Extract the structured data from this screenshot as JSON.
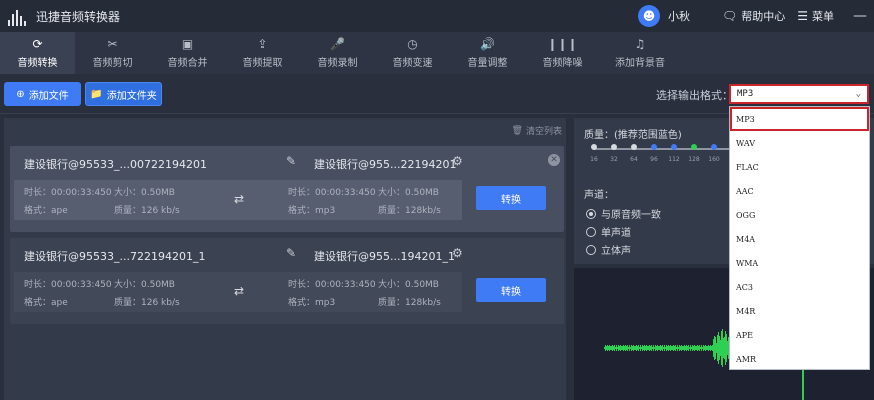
{
  "app": {
    "title": "迅捷音频转换器"
  },
  "user": {
    "avatar_icon": "user-icon",
    "name": "小秋"
  },
  "titlebar": {
    "help": "帮助中心",
    "menu": "菜单"
  },
  "toolbar": {
    "items": [
      {
        "label": "音频转换",
        "icon": "refresh-icon",
        "active": true
      },
      {
        "label": "音频剪切",
        "icon": "scissors-icon"
      },
      {
        "label": "音频合并",
        "icon": "merge-icon"
      },
      {
        "label": "音频提取",
        "icon": "extract-icon"
      },
      {
        "label": "音频录制",
        "icon": "mic-icon"
      },
      {
        "label": "音频变速",
        "icon": "speed-icon"
      },
      {
        "label": "音量调整",
        "icon": "volume-icon"
      },
      {
        "label": "音频降噪",
        "icon": "denoise-icon"
      },
      {
        "label": "添加背景音",
        "icon": "music-icon"
      }
    ]
  },
  "actions": {
    "add_file": "添加文件",
    "add_folder": "添加文件夹",
    "format_label": "选择输出格式：",
    "format_value": "MP3"
  },
  "list": {
    "clear": "清空列表",
    "files": [
      {
        "source": "建设银行@95533_...00722194201",
        "output": "建设银行@955...22194201",
        "src_duration": "时长：00:00:33:450",
        "src_size": "大小：0.50MB",
        "src_format": "格式：ape",
        "src_quality": "质量：126 kb/s",
        "dst_duration": "时长：00:00:33:450",
        "dst_size": "大小：0.50MB",
        "dst_format": "格式：mp3",
        "dst_quality": "质量：128kb/s",
        "convert": "转换"
      },
      {
        "source": "建设银行@95533_...722194201_1",
        "output": "建设银行@955...194201_1",
        "src_duration": "时长：00:00:33:450",
        "src_size": "大小：0.50MB",
        "src_format": "格式：ape",
        "src_quality": "质量：126 kb/s",
        "dst_duration": "时长：00:00:33:450",
        "dst_size": "大小：0.50MB",
        "dst_format": "格式：mp3",
        "dst_quality": "质量：128kb/s",
        "convert": "转换"
      }
    ]
  },
  "settings": {
    "quality_label": "质量：(推荐范围蓝色)",
    "quality_ticks": [
      "16",
      "32",
      "64",
      "96",
      "112",
      "128",
      "160"
    ],
    "channel_label": "声道：",
    "channels": [
      "与原音频一致",
      "单声道",
      "立体声"
    ],
    "selected_channel": 0,
    "accent_color": "#3f7bf5",
    "active_tick_color": "#2fcf54"
  },
  "dropdown": {
    "options": [
      "MP3",
      "WAV",
      "FLAC",
      "AAC",
      "OGG",
      "M4A",
      "WMA",
      "AC3",
      "M4R",
      "APE",
      "AMR"
    ],
    "selected": "MP3"
  }
}
